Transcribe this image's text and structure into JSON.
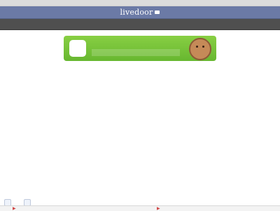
{
  "header": {
    "logo_text": "livedoor"
  },
  "nav": {
    "items": [
      "",
      "",
      ""
    ]
  },
  "promo": {
    "icon_label": "",
    "line1": "",
    "line2": ""
  },
  "article": {
    "title": "",
    "source": "",
    "time": "",
    "paragraphs": [
      "",
      "",
      ""
    ]
  },
  "related": {
    "title": "",
    "items": [
      "",
      "",
      "",
      "",
      ""
    ],
    "final": ""
  },
  "breadcrumb": "",
  "share": {
    "tweet_label": "",
    "count": "",
    "like_label": ""
  },
  "bottom": {
    "left": "",
    "right": ""
  }
}
